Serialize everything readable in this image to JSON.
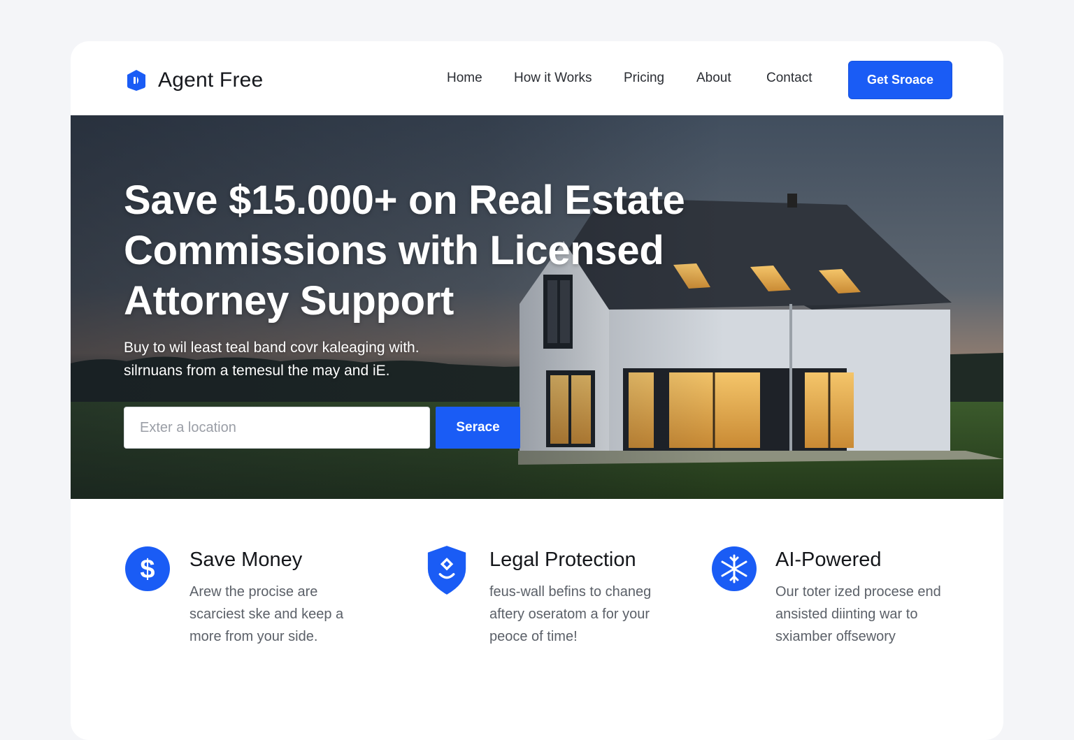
{
  "brand": {
    "name": "Agent Free",
    "logo_icon": "hexagon-logo-icon",
    "accent_color": "#1a5cf5"
  },
  "nav": {
    "links": [
      "Home",
      "How it Works",
      "Pricing",
      "About",
      "Contact"
    ],
    "cta_label": "Get Sroace"
  },
  "hero": {
    "title": "Save $15.000+ on Real Estate Commissions with Licensed Attorney Support",
    "subtitle_line1": "Buy to wil least teal band covr kaleaging with.",
    "subtitle_line2": "silrnuans from a temesul the may and iE.",
    "search_placeholder": "Exter a location",
    "search_button": "Serace"
  },
  "features": [
    {
      "icon": "dollar-icon",
      "title": "Save Money",
      "text": "Arew the procise are scarciest ske and keep a more from your side."
    },
    {
      "icon": "shield-icon",
      "title": "Legal Protection",
      "text": "feus-wall befins to chaneg aftery oseratom a for your peoce of time!"
    },
    {
      "icon": "snowflake-icon",
      "title": "AI-Powered",
      "text": "Our toter ized procese end ansisted diinting war to sxiamber offsewory"
    }
  ]
}
